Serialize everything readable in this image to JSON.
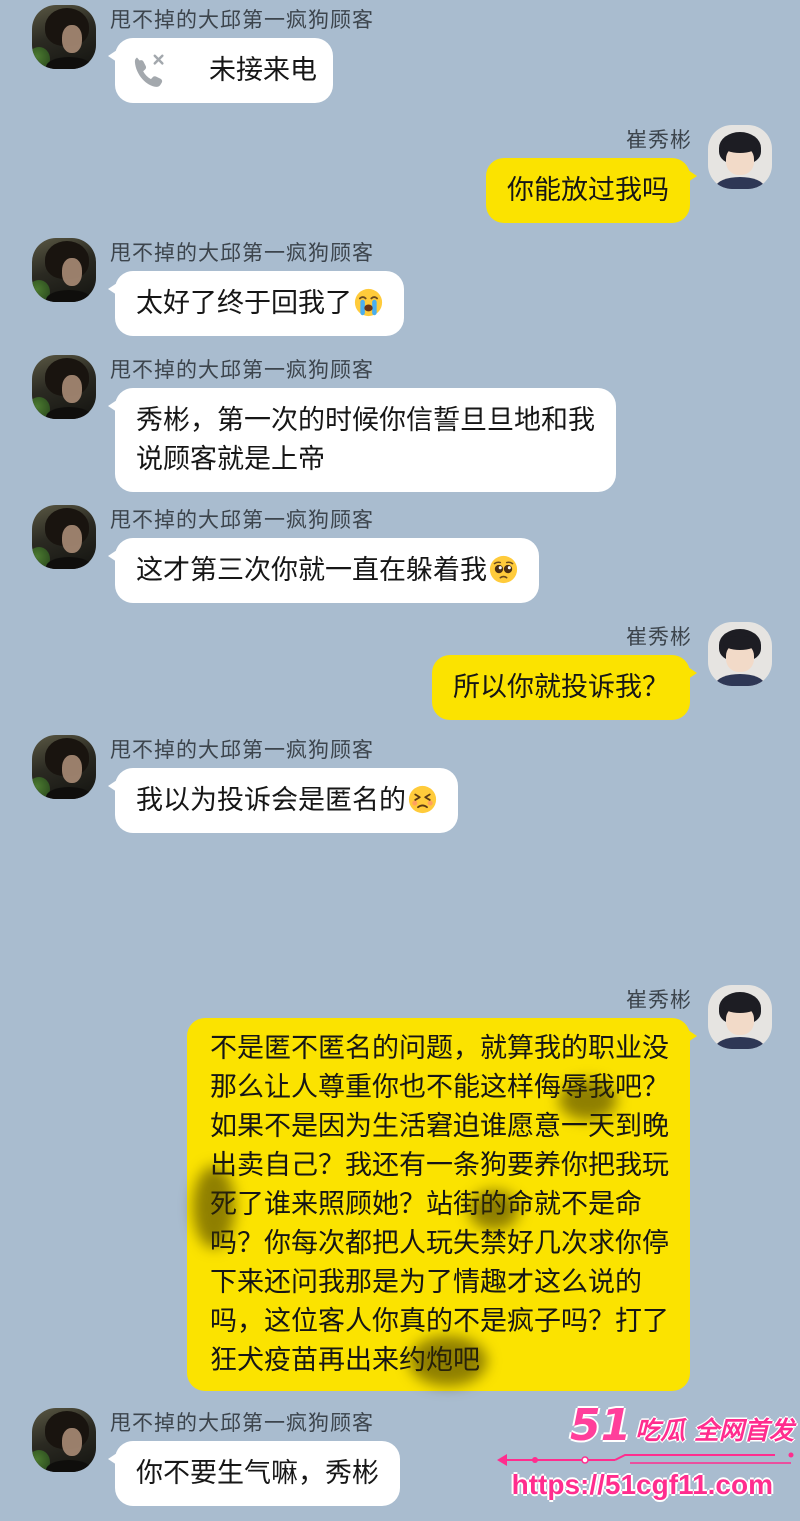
{
  "colors": {
    "background": "#a9bccf",
    "incoming_bubble": "#ffffff",
    "outgoing_bubble": "#fbe300",
    "watermark": "#ff2d8e"
  },
  "chat": {
    "messages": [
      {
        "sender": "甩不掉的大邱第一疯狗顾客",
        "icon": "missed-call-icon",
        "text": "未接来电"
      },
      {
        "sender": "崔秀彬",
        "lines": [
          "你能放过我吗"
        ]
      },
      {
        "sender": "甩不掉的大邱第一疯狗顾客",
        "lines": [
          "太好了终于回我了"
        ],
        "emoji": "loudly-crying-face-icon"
      },
      {
        "sender": "甩不掉的大邱第一疯狗顾客",
        "lines": [
          "秀彬，第一次的时候你信誓旦旦地和我",
          "说顾客就是上帝"
        ]
      },
      {
        "sender": "甩不掉的大邱第一疯狗顾客",
        "lines": [
          "这才第三次你就一直在躲着我"
        ],
        "emoji": "pleading-face-icon"
      },
      {
        "sender": "崔秀彬",
        "lines": [
          "所以你就投诉我？"
        ]
      },
      {
        "sender": "甩不掉的大邱第一疯狗顾客",
        "lines": [
          "我以为投诉会是匿名的"
        ],
        "emoji": "persevering-face-icon"
      },
      {
        "sender": "崔秀彬",
        "lines": [
          "不是匿不匿名的问题，就算我的职业没",
          "那么让人尊重你也不能这样侮辱我吧？",
          "如果不是因为生活窘迫谁愿意一天到晚",
          "出卖自己？我还有一条狗要养你把我玩",
          "死了谁来照顾她？站街的命就不是命",
          "吗？你每次都把人玩失禁好几次求你停",
          "下来还问我那是为了情趣才这么说的",
          "吗，这位客人你真的不是疯子吗？打了",
          "狂犬疫苗再出来约炮吧"
        ]
      },
      {
        "sender": "甩不掉的大邱第一疯狗顾客",
        "lines": [
          "你不要生气嘛，秀彬"
        ]
      }
    ]
  },
  "watermark": {
    "brand_number": "51",
    "brand_text": "吃瓜 全网首发",
    "url": "https://51cgf11.com"
  }
}
